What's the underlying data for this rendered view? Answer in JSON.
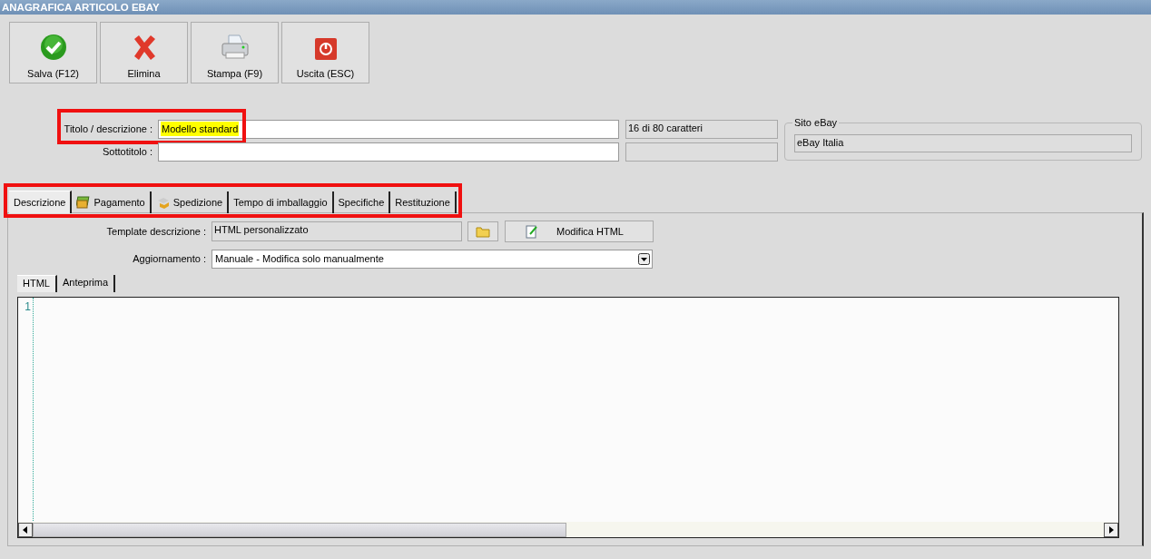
{
  "window": {
    "title": "ANAGRAFICA ARTICOLO EBAY"
  },
  "toolbar": [
    {
      "label": "Salva (F12)",
      "kind": "save"
    },
    {
      "label": "Elimina",
      "kind": "delete"
    },
    {
      "label": "Stampa (F9)",
      "kind": "print"
    },
    {
      "label": "Uscita (ESC)",
      "kind": "exit"
    }
  ],
  "title_field": {
    "label": "Titolo / descrizione :",
    "value": "Modello standard",
    "counter": "16 di 80 caratteri"
  },
  "subtitle_field": {
    "label": "Sottotitolo :"
  },
  "site": {
    "legend": "Sito eBay",
    "value": "eBay Italia"
  },
  "tabs": [
    {
      "label": "Descrizione",
      "selected": true,
      "kind": "plain"
    },
    {
      "label": "Pagamento",
      "selected": false,
      "kind": "money"
    },
    {
      "label": "Spedizione",
      "selected": false,
      "kind": "box"
    },
    {
      "label": "Tempo di imballaggio",
      "selected": false,
      "kind": "plain"
    },
    {
      "label": "Specifiche",
      "selected": false,
      "kind": "plain"
    },
    {
      "label": "Restituzione",
      "selected": false,
      "kind": "plain"
    }
  ],
  "template": {
    "label": "Template descrizione :",
    "value": "HTML personalizzato",
    "edit_button": "Modifica HTML"
  },
  "update": {
    "label": "Aggiornamento :",
    "value": "Manuale - Modifica solo manualmente"
  },
  "editor_tabs": [
    {
      "label": "HTML",
      "selected": true
    },
    {
      "label": "Anteprima",
      "selected": false
    }
  ],
  "editor": {
    "line_numbers": [
      "1"
    ]
  }
}
